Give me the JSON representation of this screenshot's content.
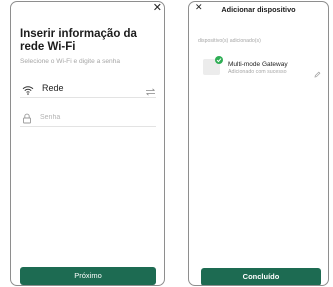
{
  "left_screen": {
    "close_glyph": "✕",
    "title": "Inserir informação da rede Wi-Fi",
    "subtitle": "Selecione o Wi-Fi e digite a senha",
    "wifi": {
      "icon": "wifi-icon",
      "network_label": "Rede",
      "switch_icon": "switch-arrows-icon"
    },
    "password": {
      "icon": "lock-icon",
      "placeholder": "Senha",
      "value": ""
    },
    "next_button": "Próximo"
  },
  "right_screen": {
    "close_glyph": "✕",
    "title": "Adicionar dispositivo",
    "added_devices_label": "dispositivo(s) adicionado(s)",
    "device": {
      "name": "Multi-mode Gateway",
      "status": "Adicionado com sucesso",
      "status_icon": "check-icon",
      "edit_icon": "pencil-icon"
    },
    "done_button": "Concluído"
  },
  "colors": {
    "primary": "#1d6b52",
    "success": "#2fae55",
    "muted_text": "#a6a6a6"
  }
}
